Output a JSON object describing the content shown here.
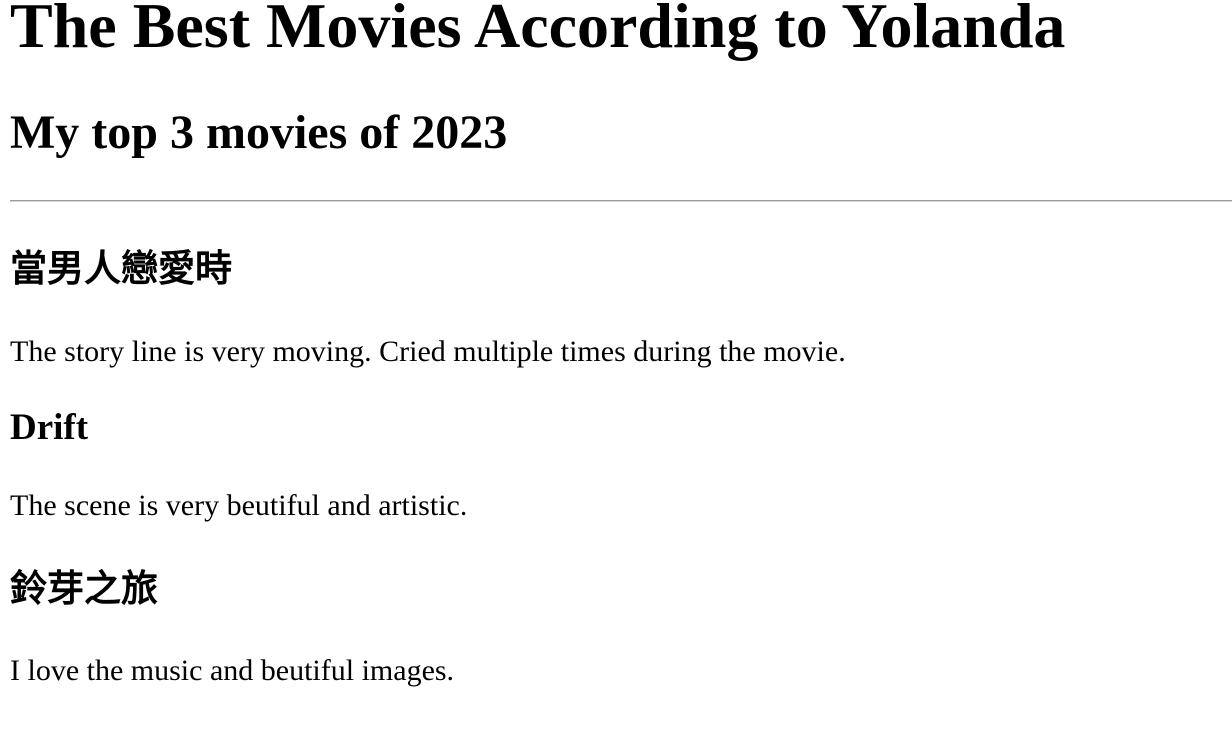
{
  "page": {
    "title": "The Best Movies According to Yolanda",
    "subtitle": "My top 3 movies of 2023"
  },
  "movies": [
    {
      "title": "當男人戀愛時",
      "review": "The story line is very moving. Cried multiple times during the movie."
    },
    {
      "title": "Drift",
      "review": "The scene is very beutiful and artistic."
    },
    {
      "title": "鈴芽之旅",
      "review": "I love the music and beutiful images."
    }
  ]
}
